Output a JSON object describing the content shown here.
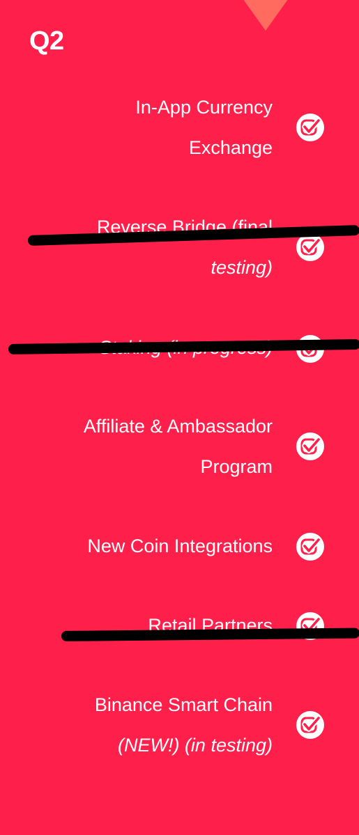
{
  "quarter": {
    "label": "Q2"
  },
  "roadmap": {
    "items": [
      {
        "lines": [
          "In-App Currency",
          "Exchange"
        ],
        "italic": [
          false,
          false
        ],
        "done": true
      },
      {
        "lines": [
          "Reverse Bridge (final",
          "testing)"
        ],
        "italic": [
          false,
          true
        ],
        "done": true
      },
      {
        "lines": [
          "Staking (in progress)"
        ],
        "italic": [
          true
        ],
        "done": true
      },
      {
        "lines": [
          "Affiliate & Ambassador",
          "Program"
        ],
        "italic": [
          false,
          false
        ],
        "done": true
      },
      {
        "lines": [
          "New Coin Integrations"
        ],
        "italic": [
          false
        ],
        "done": true
      },
      {
        "lines": [
          "Retail Partners"
        ],
        "italic": [
          false
        ],
        "done": true
      },
      {
        "lines": [
          "Binance Smart Chain",
          "(NEW!) (in testing)"
        ],
        "italic": [
          false,
          true
        ],
        "done": true
      }
    ]
  },
  "colors": {
    "background": "#FF1F4B",
    "accent_notch": "#FF6B5F",
    "text": "#FFFFFF",
    "marker_strike": "#000000"
  },
  "icons": {
    "status": "checkbox-check-icon"
  }
}
